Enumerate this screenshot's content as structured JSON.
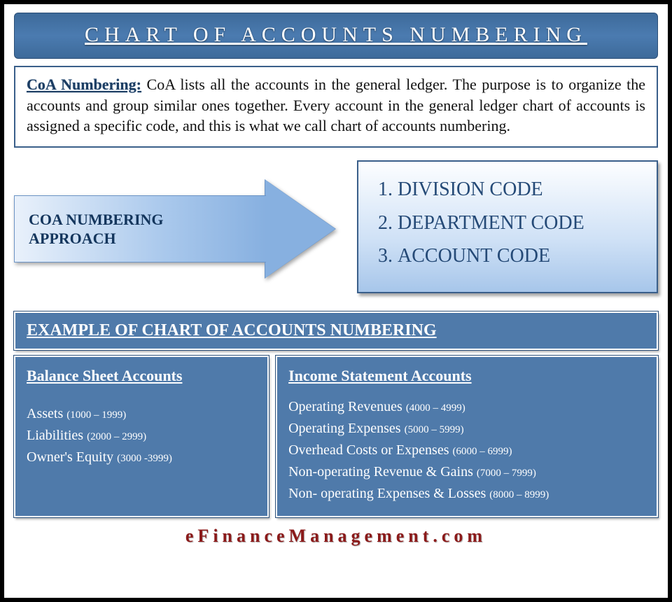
{
  "title": "CHART OF ACCOUNTS NUMBERING",
  "intro": {
    "lead": "CoA Numbering:",
    "body": "CoA lists all the accounts in the general ledger. The purpose is to organize the accounts and group similar ones together. Every account in the general ledger chart of accounts is assigned a specific code, and this is what we call chart of accounts numbering."
  },
  "approach": {
    "arrow_label": "COA NUMBERING APPROACH",
    "codes": [
      "DIVISION CODE",
      "DEPARTMENT CODE",
      "ACCOUNT CODE"
    ]
  },
  "example": {
    "header": "EXAMPLE OF CHART OF ACCOUNTS NUMBERING",
    "balance": {
      "title": "Balance Sheet Accounts",
      "items": [
        {
          "label": "Assets",
          "range": "(1000 – 1999)"
        },
        {
          "label": "Liabilities",
          "range": "(2000 – 2999)"
        },
        {
          "label": "Owner's Equity",
          "range": "(3000 -3999)"
        }
      ]
    },
    "income": {
      "title": "Income Statement Accounts",
      "items": [
        {
          "label": "Operating Revenues",
          "range": "(4000 – 4999)"
        },
        {
          "label": "Operating Expenses",
          "range": "(5000 – 5999)"
        },
        {
          "label": "Overhead Costs or Expenses",
          "range": "(6000 – 6999)"
        },
        {
          "label": "Non-operating Revenue & Gains",
          "range": "(7000 – 7999)"
        },
        {
          "label": "Non- operating Expenses & Losses",
          "range": "(8000 – 8999)"
        }
      ]
    }
  },
  "brand": "eFinanceManagement.com"
}
